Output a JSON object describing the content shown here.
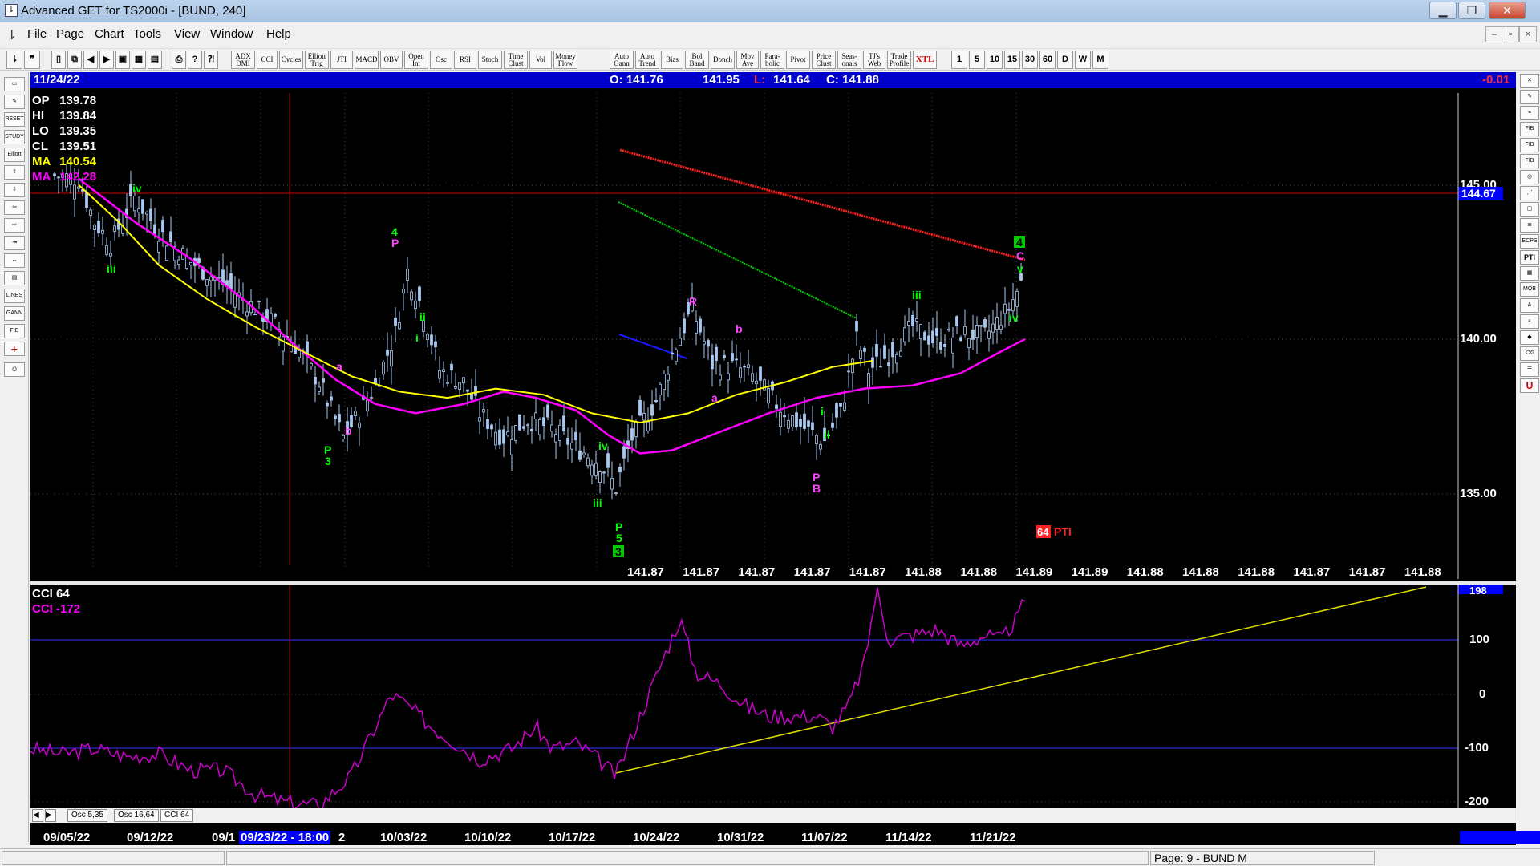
{
  "window": {
    "title": "Advanced GET for TS2000i - [BUND, 240]"
  },
  "menu": [
    "File",
    "Page",
    "Chart",
    "Tools",
    "View",
    "Window",
    "Help"
  ],
  "toolbar": {
    "indicators": [
      "ADX DMI",
      "CCI",
      "Cycles",
      "Elliott Trig",
      "JTI",
      "MACD",
      "OBV",
      "Open Int",
      "Osc",
      "RSI",
      "Stoch",
      "Time Clust",
      "Vol",
      "Money Flow"
    ],
    "studies": [
      "Auto Gann",
      "Auto Trend",
      "Bias",
      "Bol Band",
      "Donch",
      "Mov Ave",
      "Para- bolic",
      "Pivot",
      "Price Clust",
      "Seas- onals",
      "TJ's Web",
      "Trade Profile"
    ],
    "xtl": "XTL",
    "intervals": [
      "1",
      "5",
      "10",
      "15",
      "30",
      "60",
      "D",
      "W",
      "M"
    ]
  },
  "header": {
    "date": "11/24/22",
    "open": "O: 141.76",
    "high": "141.95",
    "low_label": "L:",
    "low": "141.64",
    "close": "C: 141.88",
    "change": "-0.01"
  },
  "ohlc_box": {
    "op": "139.78",
    "hi": "139.84",
    "lo": "139.35",
    "cl": "139.51",
    "ma1": "140.54",
    "ma2": "142.28",
    "labels": {
      "op": "OP",
      "hi": "HI",
      "lo": "LO",
      "cl": "CL",
      "ma": "MA"
    }
  },
  "price_axis": {
    "ticks": [
      "145.00",
      "140.00",
      "135.00"
    ],
    "current": "144.67"
  },
  "forecast_row": [
    "141.87",
    "141.87",
    "141.87",
    "141.87",
    "141.87",
    "141.88",
    "141.88",
    "141.89",
    "141.89",
    "141.88",
    "141.88",
    "141.88",
    "141.87",
    "141.87",
    "141.88"
  ],
  "pti": {
    "value": "64",
    "label": "PTI"
  },
  "wave_labels": {
    "top4": "4",
    "topC": "C",
    "topv": "v",
    "topiv": "iv",
    "iii_right": "iii",
    "mid4": "4",
    "mid_iii": "iii",
    "left_iv": "iv",
    "left_iii": "iii",
    "a1": "a",
    "b1": "b",
    "p3": "3",
    "p3b": "P",
    "ii": "ii",
    "i": "i",
    "iv2": "iv",
    "iii2": "iii",
    "p5": "5",
    "p5b": "P",
    "box3": "3",
    "R": "R",
    "b2": "b",
    "a2": "a",
    "i2": "i",
    "ii2": "ii",
    "B": "B",
    "Pb": "P"
  },
  "cci": {
    "title": "CCI 64",
    "value_label": "CCI  -172",
    "ticks": [
      "198",
      "100",
      "0",
      "-100",
      "-200"
    ]
  },
  "osc_tabs": [
    "Osc 5,35",
    "Osc 16,64",
    "CCI 64"
  ],
  "dates": [
    "09/05/22",
    "09/12/22",
    "09/1",
    "09/23/22 - 18:00",
    "2",
    "10/03/22",
    "10/10/22",
    "10/17/22",
    "10/24/22",
    "10/31/22",
    "11/07/22",
    "11/14/22",
    "11/21/22"
  ],
  "status": {
    "page": "Page: 9 - BUND M"
  },
  "colors": {
    "bg": "#000000",
    "candles": "#a8c8f0",
    "ma_fast": "#ffff00",
    "ma_slow": "#ff00ff",
    "wave_green": "#00ff00",
    "wave_magenta": "#ff44ff",
    "infobar": "#0000cc",
    "trend_red": "#ff2020",
    "trend_green": "#00cc00",
    "trend_blue": "#1a1aff"
  }
}
